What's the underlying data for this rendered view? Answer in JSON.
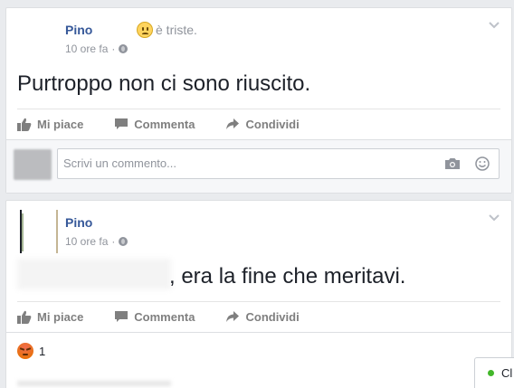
{
  "post1": {
    "author": "Pino",
    "feeling_text": "è triste.",
    "feeling_icon": "sad-emoji-icon",
    "time": "10 ore fa",
    "audience_icon": "globe-icon",
    "text": "Purtroppo non ci sono riuscito.",
    "actions": {
      "like": "Mi piace",
      "comment": "Commenta",
      "share": "Condividi"
    },
    "comment_placeholder": "Scrivi un commento..."
  },
  "post2": {
    "author": "Pino",
    "time": "10 ore fa",
    "audience_icon": "globe-icon",
    "text": ", era la fine che meritavi.",
    "actions": {
      "like": "Mi piace",
      "comment": "Commenta",
      "share": "Condividi"
    },
    "reaction_icon": "angry-reaction-icon",
    "reaction_count": "1"
  },
  "chat": {
    "label": "Cl",
    "status_color": "#42b72a"
  },
  "colors": {
    "link": "#365899",
    "muted": "#90949c",
    "background": "#e9ebee"
  }
}
